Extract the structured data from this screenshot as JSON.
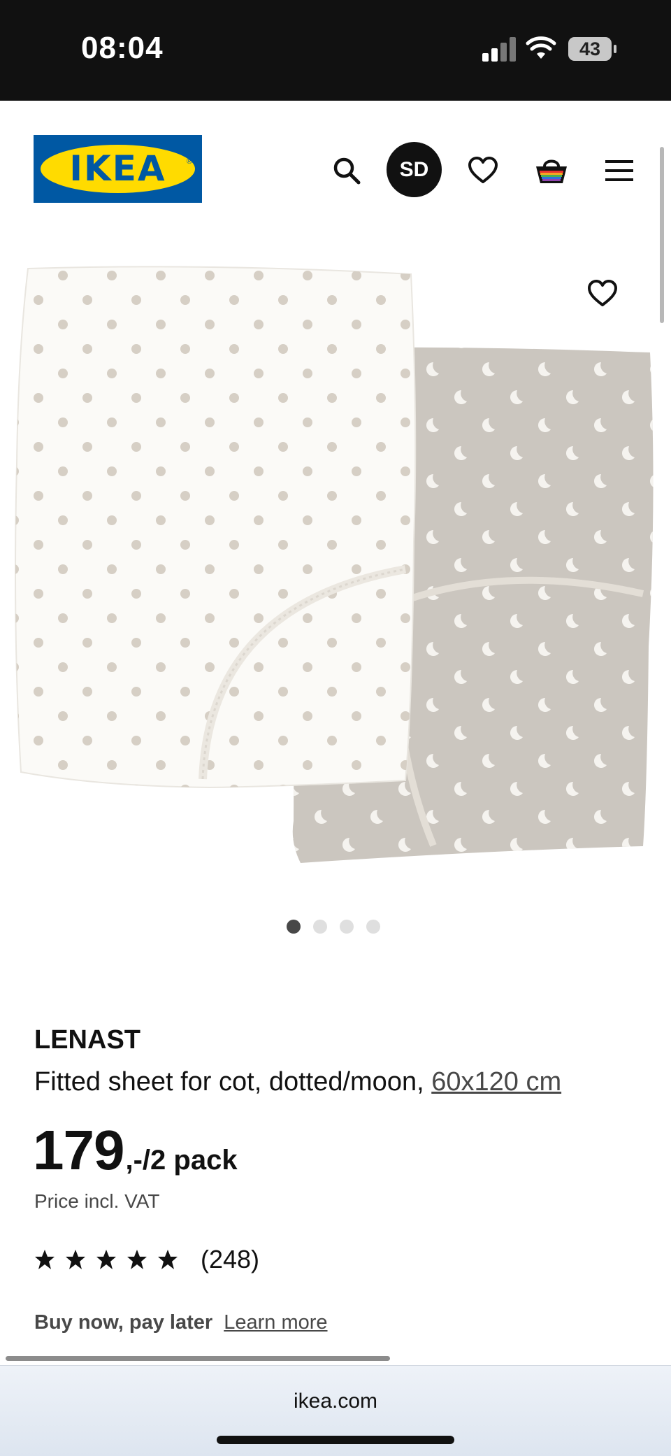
{
  "status_bar": {
    "time": "08:04",
    "battery": "43",
    "icons": [
      "signal-icon",
      "wifi-icon",
      "battery-icon"
    ]
  },
  "header": {
    "logo_text": "IKEA",
    "avatar_initials": "SD",
    "icons": [
      "search-icon",
      "heart-icon",
      "shopping-bag-icon",
      "hamburger-menu-icon"
    ]
  },
  "carousel": {
    "total_images": 4,
    "active_index": 0
  },
  "product": {
    "name": "LENAST",
    "description": "Fitted sheet for cot, dotted/moon,",
    "size": "60x120 cm",
    "price_main": "179",
    "price_suffix": ",-/2 pack",
    "price_note": "Price incl. VAT",
    "rating_stars": 5,
    "rating_count": "(248)",
    "bnpl_title": "Buy now, pay later",
    "bnpl_link": "Learn more"
  },
  "browser": {
    "url": "ikea.com"
  },
  "colors": {
    "ikea_blue": "#0058a3",
    "ikea_yellow": "#ffdb00",
    "text": "#111111",
    "secondary_text": "#484848"
  }
}
